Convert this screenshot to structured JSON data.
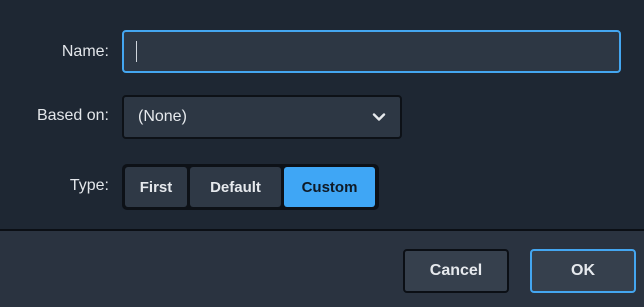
{
  "form": {
    "name_label": "Name:",
    "name_value": "",
    "based_on_label": "Based on:",
    "based_on_value": "(None)",
    "type_label": "Type:",
    "type_options": [
      "First",
      "Default",
      "Custom"
    ],
    "type_selected": "Custom"
  },
  "footer": {
    "cancel_label": "Cancel",
    "ok_label": "OK"
  },
  "colors": {
    "background": "#1e2733",
    "accent": "#3fa6f5",
    "field": "#2d3744"
  },
  "icons": {
    "dropdown": "chevron-down-icon"
  }
}
